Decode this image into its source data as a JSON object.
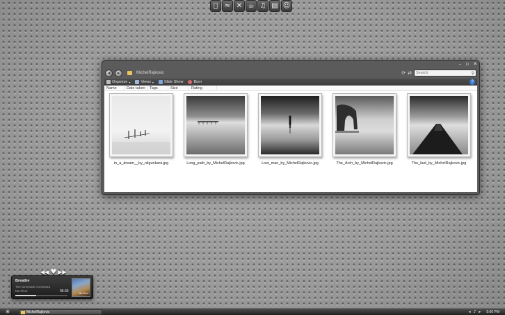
{
  "dock": {
    "icons": [
      "apple-icon",
      "wifi-icon",
      "tools-icon",
      "cup-icon",
      "music-icon",
      "notes-icon",
      "finder-icon"
    ],
    "glyphs": [
      "",
      "≈",
      "✕",
      "☕",
      "♫",
      "▤",
      "☺"
    ]
  },
  "explorer": {
    "address_path": "MichelRajkovic",
    "search_placeholder": "Search",
    "window_controls": [
      "–",
      "▫",
      "✕"
    ],
    "toolbar": {
      "organize": "Organize",
      "views": "Views",
      "slideshow": "Slide Show",
      "burn": "Burn"
    },
    "columns": [
      "Name",
      "Date taken",
      "Tags",
      "Size",
      "Rating"
    ],
    "files": [
      "in_a_dream__by_nilgunkara.jpg",
      "Long_path_by_MichelRajkovic.jpg",
      "Lost_man_by_MichelRajkovic.jpg",
      "The_Arch_by_MichelRajkovic.jpg",
      "The_last_by_MichelRajkovic.jpg"
    ]
  },
  "player": {
    "title": "Breathe",
    "artist": "The Cinematic Orchestra",
    "album": "Ma Fleur",
    "time": "06:33",
    "progress": 0.4,
    "controls": [
      "◀◀",
      "♥",
      "▶▶"
    ],
    "art_caption": "Ma Fleur"
  },
  "taskbar": {
    "start_glyph": "✳",
    "task_label": "MichelRajkovic",
    "tray_icons": [
      "◂",
      "♪",
      "▸"
    ],
    "clock": "5:00 PM"
  },
  "colors": {
    "folder": "#e9c65a",
    "window_chrome": "#5b5b5b",
    "help": "#3a7bd5"
  }
}
